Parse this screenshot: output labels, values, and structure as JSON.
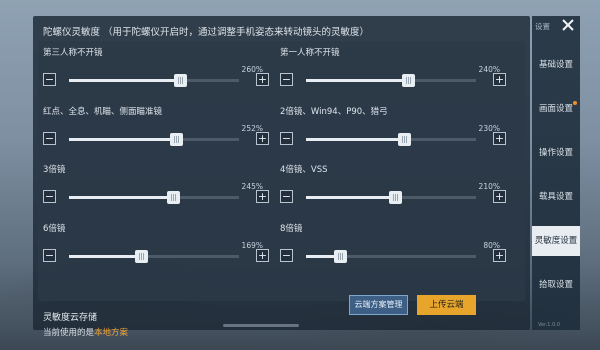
{
  "header": {
    "title": "陀螺仪灵敏度",
    "note": "（用于陀螺仪开启时，通过调整手机姿态来转动镜头的灵敏度）"
  },
  "sliders": [
    {
      "label": "第三人称不开镜",
      "value_text": "260%",
      "value": 260,
      "min": 0,
      "max": 400
    },
    {
      "label": "第一人称不开镜",
      "value_text": "240%",
      "value": 240,
      "min": 0,
      "max": 400
    },
    {
      "label": "红点、全息、机瞄、侧面瞄准镜",
      "value_text": "252%",
      "value": 252,
      "min": 0,
      "max": 400
    },
    {
      "label": "2倍镜、Win94、P90、猎弓",
      "value_text": "230%",
      "value": 230,
      "min": 0,
      "max": 400
    },
    {
      "label": "3倍镜",
      "value_text": "245%",
      "value": 245,
      "min": 0,
      "max": 400
    },
    {
      "label": "4倍镜、VSS",
      "value_text": "210%",
      "value": 210,
      "min": 0,
      "max": 400
    },
    {
      "label": "6倍镜",
      "value_text": "169%",
      "value": 169,
      "min": 0,
      "max": 400
    },
    {
      "label": "8倍镜",
      "value_text": "80%",
      "value": 80,
      "min": 0,
      "max": 400
    }
  ],
  "controls": {
    "minus": "−",
    "plus": "+"
  },
  "cloud": {
    "title": "灵敏度云存储",
    "current_prefix": "当前使用的是",
    "current_plan": "本地方案",
    "manage_label": "云端方案管理",
    "upload_label": "上传云端"
  },
  "sidebar": {
    "top_label": "设置",
    "items": [
      {
        "label": "基础设置",
        "active": false,
        "badge": false
      },
      {
        "label": "画面设置",
        "active": false,
        "badge": true
      },
      {
        "label": "操作设置",
        "active": false,
        "badge": false
      },
      {
        "label": "载具设置",
        "active": false,
        "badge": false
      },
      {
        "label": "灵敏度设置",
        "active": true,
        "badge": false
      },
      {
        "label": "拾取设置",
        "active": false,
        "badge": false
      }
    ],
    "bottom_text": "Ver.1.0.0"
  },
  "colors": {
    "accent_orange": "#e7a52c",
    "plan_text": "#f0a43a",
    "badge": "#f08c2a"
  },
  "icons": {
    "close": "close-icon"
  }
}
